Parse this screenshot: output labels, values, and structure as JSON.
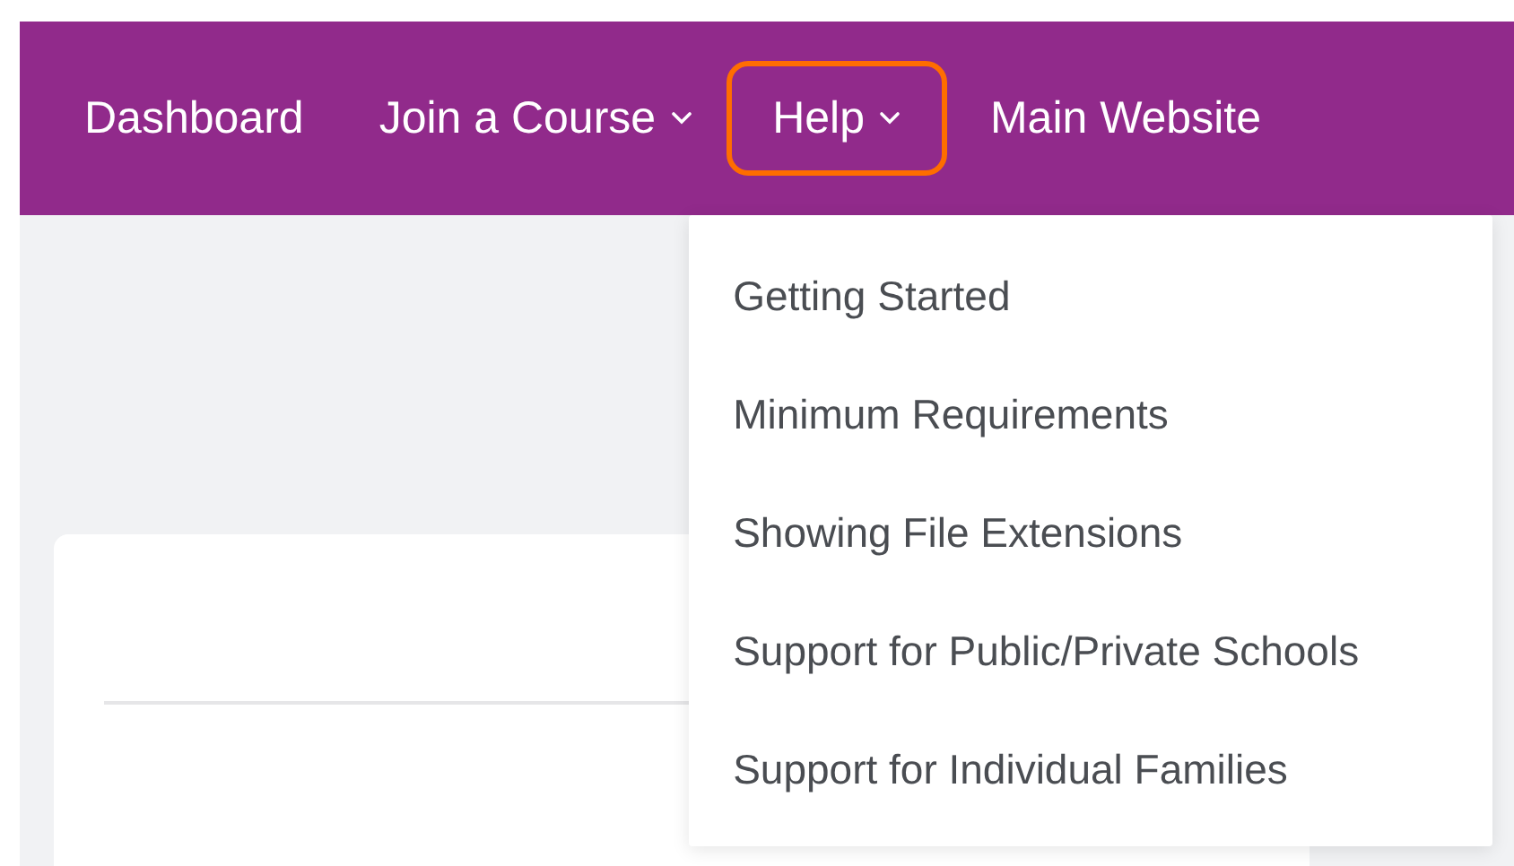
{
  "nav": {
    "items": [
      {
        "label": "Dashboard",
        "caret": false,
        "focused": false
      },
      {
        "label": "Join a Course",
        "caret": true,
        "focused": false
      },
      {
        "label": "Help",
        "caret": true,
        "focused": true,
        "menu": [
          "Getting Started",
          "Minimum Requirements",
          "Showing File Extensions",
          "Support for Public/Private Schools",
          "Support for Individual Families"
        ]
      },
      {
        "label": "Main Website",
        "caret": false,
        "focused": false
      }
    ]
  }
}
